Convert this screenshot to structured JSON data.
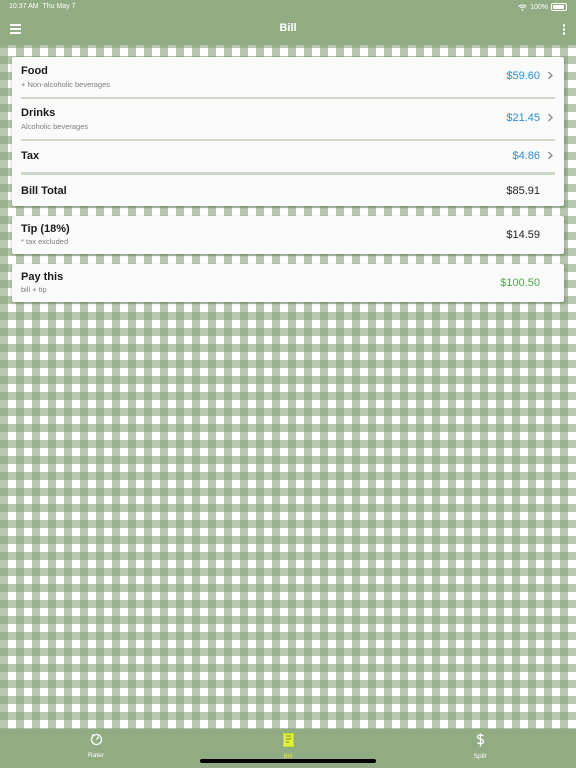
{
  "status_bar": {
    "time": "10:37 AM",
    "date": "Thu May 7",
    "battery": "100%"
  },
  "nav": {
    "title": "Bill"
  },
  "bill": {
    "food": {
      "title": "Food",
      "subtitle": "+ Non-alcoholic beverages",
      "amount": "$59.60"
    },
    "drinks": {
      "title": "Drinks",
      "subtitle": "Alcoholic beverages",
      "amount": "$21.45"
    },
    "tax": {
      "title": "Tax",
      "amount": "$4.86"
    },
    "total": {
      "title": "Bill Total",
      "amount": "$85.91"
    }
  },
  "tip": {
    "title": "Tip (18%)",
    "subtitle": "* tax excluded",
    "amount": "$14.59"
  },
  "pay": {
    "title": "Pay this",
    "subtitle": "bill + tip",
    "amount": "$100.50"
  },
  "tabs": [
    {
      "label": "Rater",
      "icon": "rater-dial-icon"
    },
    {
      "label": "Bill",
      "icon": "bill-receipt-icon",
      "active": true
    },
    {
      "label": "Split",
      "icon": "split-dollar-icon"
    }
  ],
  "colors": {
    "bar": "#91ab83",
    "amount_blue": "#2a8fd6",
    "amount_green": "#4aa84a",
    "active_tab": "#e0ee3c"
  }
}
